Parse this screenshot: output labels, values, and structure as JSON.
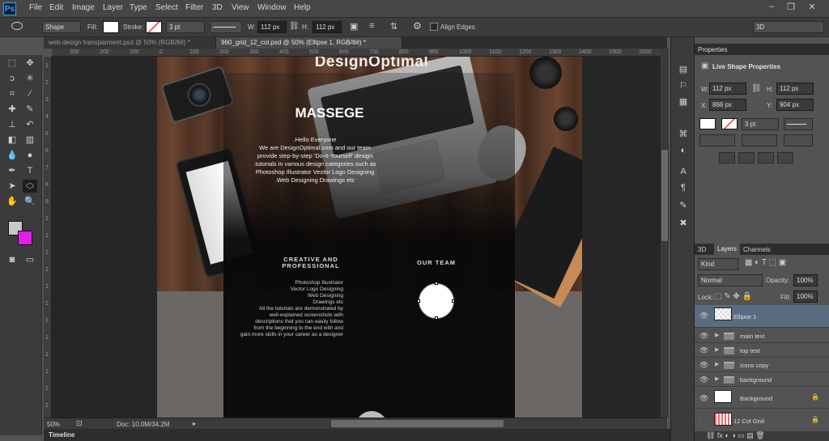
{
  "app": {
    "logo": "Ps"
  },
  "menu": [
    "File",
    "Edit",
    "Image",
    "Layer",
    "Type",
    "Select",
    "Filter",
    "3D",
    "View",
    "Window",
    "Help"
  ],
  "window_controls": {
    "minimize": "–",
    "maximize": "❐",
    "close": "✕"
  },
  "options": {
    "tool_mode": "Shape",
    "fill_label": "Fill:",
    "stroke_label": "Stroke:",
    "stroke_width": "3 pt",
    "w_label": "W:",
    "w_value": "112 px",
    "h_label": "H:",
    "h_value": "112 px",
    "align_edges": "Align Edges",
    "workspace": "3D",
    "fill_color": "#ffffff",
    "stroke_color": "#ffffff"
  },
  "tabs": [
    {
      "label": "web design transparment.psd @ 50% (RGB/8#) *",
      "active": false
    },
    {
      "label": "960_grid_12_col.psd @ 50% (Ellipse 1, RGB/8#) *",
      "active": true
    }
  ],
  "ruler_top": [
    "300",
    "200",
    "100",
    "0",
    "100",
    "200",
    "300",
    "400",
    "500",
    "600",
    "700",
    "800",
    "900",
    "1000",
    "1100",
    "1200",
    "1300",
    "1400",
    "1500",
    "1600"
  ],
  "ruler_left": [
    "1",
    "2",
    "3",
    "4",
    "5",
    "6",
    "7",
    "8",
    "9",
    "1",
    "1",
    "1",
    "1",
    "1",
    "1",
    "1",
    "1",
    "1",
    "1",
    "2",
    "2"
  ],
  "canvas": {
    "logo_text": "DesignOptimal",
    "heading": "MASSEGE",
    "hello_lines": [
      ".Hello Everyone",
      "We are DesignOptimal.com and our team",
      "provide step-by-step 'Do-it-Yourself' design",
      ".tutorials in various design categories such as",
      "Photoshop Illustrator Vector Logo Designing",
      ".Web Designing Drawings etc"
    ],
    "creative_title": "CREATIVE AND PROFESSIONAL",
    "creative_lines": [
      "Photoshop Illustrator",
      "Vector Logo Designing",
      "Web Designing",
      "Drawings etc",
      "All the tutorials are demonstrated by",
      "well-explained screenshots with",
      "descriptions that you can easily follow",
      "from the beginning to the end with and",
      "gain more skills in your career as a designer"
    ],
    "our_team": "OUR TEAM"
  },
  "status": {
    "zoom": "50%",
    "doc": "Doc: 10.0M/34.2M"
  },
  "timeline_label": "Timeline",
  "properties": {
    "tab": "Properties",
    "title": "Live Shape Properties",
    "w_label": "W:",
    "w": "112 px",
    "h_label": "H:",
    "h": "112 px",
    "x_label": "X:",
    "x": "866 px",
    "y_label": "Y:",
    "y": "904 px",
    "stroke": "3 pt"
  },
  "layers_panel": {
    "tabs": [
      "3D",
      "Layers",
      "Channels"
    ],
    "kind": "Kind",
    "blend": "Normal",
    "opacity_label": "Opacity:",
    "opacity": "100%",
    "lock_label": "Lock:",
    "fill_label": "Fill:",
    "fill": "100%",
    "layers": [
      {
        "name": "Ellipse 1",
        "type": "shape",
        "selected": true
      },
      {
        "name": "main text",
        "type": "group"
      },
      {
        "name": "top text",
        "type": "group"
      },
      {
        "name": "icons copy",
        "type": "group"
      },
      {
        "name": "background",
        "type": "group"
      },
      {
        "name": "Background",
        "type": "image",
        "locked": true
      },
      {
        "name": "12 Col Grid",
        "type": "image",
        "locked": true
      }
    ]
  },
  "colors": {
    "foreground": "#c8c8c8",
    "background": "#e11fe6",
    "selected_layer": "#5a6c82",
    "ps_blue": "#31a8ff"
  }
}
